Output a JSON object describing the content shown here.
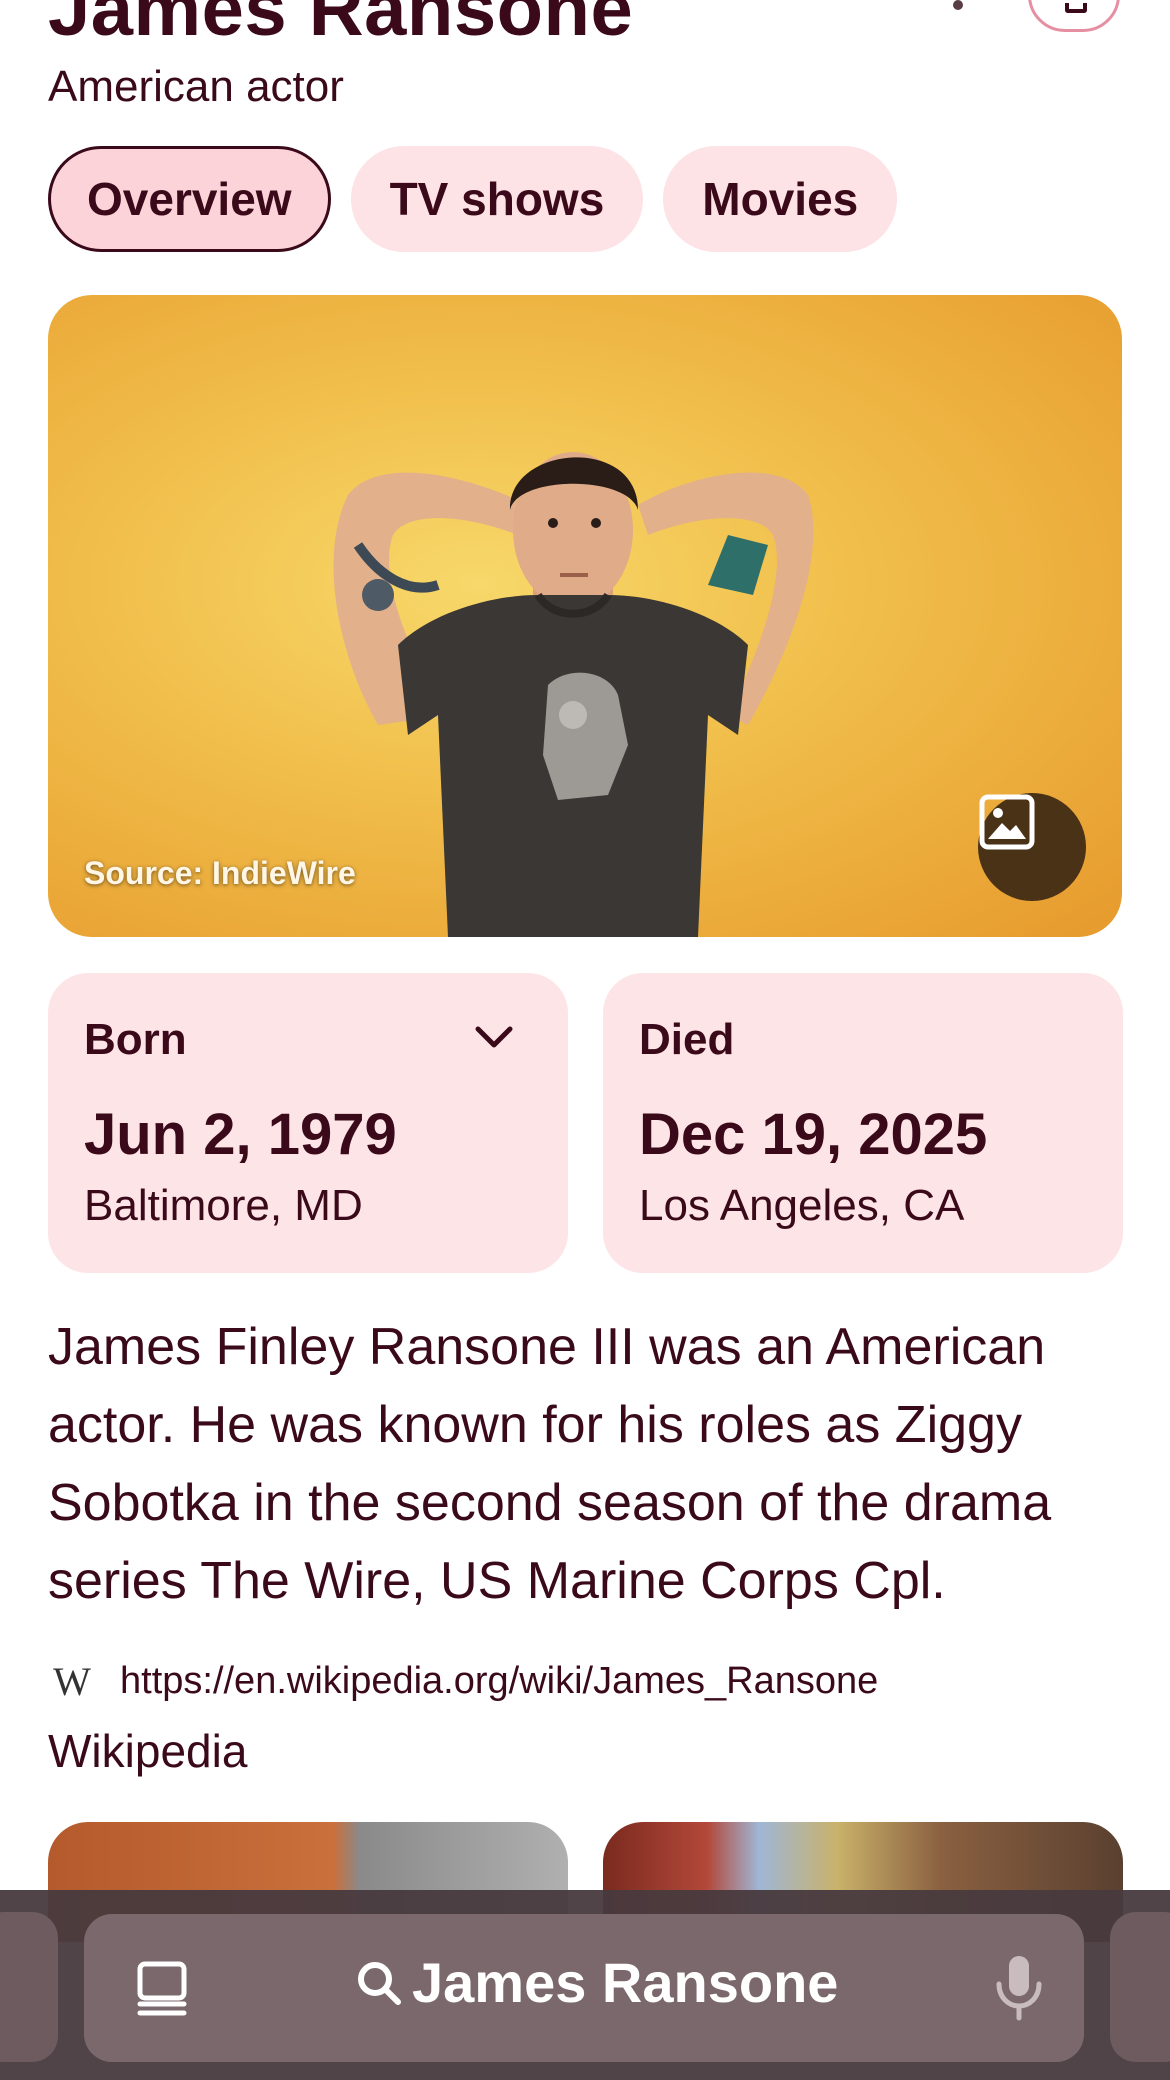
{
  "header": {
    "title": "James Ransone",
    "subtitle": "American actor"
  },
  "tabs": [
    {
      "label": "Overview",
      "active": true
    },
    {
      "label": "TV shows",
      "active": false
    },
    {
      "label": "Movies",
      "active": false
    }
  ],
  "hero": {
    "source": "Source: IndieWire",
    "gallery_icon": "image-icon"
  },
  "facts": {
    "born": {
      "label": "Born",
      "date": "Jun 2, 1979",
      "place": "Baltimore, MD"
    },
    "died": {
      "label": "Died",
      "date": "Dec 19, 2025",
      "place": "Los Angeles, CA"
    }
  },
  "description": "James Finley Ransone III was an American actor. He was known for his roles as Ziggy Sobotka in the second season of the drama series The Wire, US Marine Corps Cpl.",
  "source_link": {
    "logo": "W",
    "url": "https://en.wikipedia.org/wiki/James_Ransone",
    "name": "Wikipedia"
  },
  "search_bar": {
    "query": "James Ransone",
    "left_icon": "tabs-icon",
    "right_icon": "mic-icon"
  },
  "colors": {
    "accent_text": "#3b0a1a",
    "chip_background": "#fde2e6",
    "card_background": "#fde4e7",
    "hero_background": "#f1bf4c"
  }
}
